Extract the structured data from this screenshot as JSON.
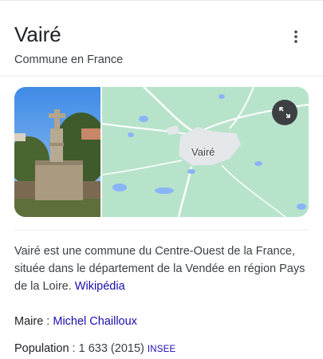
{
  "header": {
    "title": "Vairé",
    "subtitle": "Commune en France"
  },
  "map": {
    "label": "Vairé"
  },
  "description": {
    "text": "Vairé est une commune du Centre-Ouest de la France, située dans le département de la Vendée en région Pays de la Loire.",
    "source": "Wikipédia"
  },
  "facts": {
    "mayor_label": "Maire",
    "mayor_sep": " : ",
    "mayor_value": "Michel Chailloux",
    "population_label": "Population",
    "population_value": " : 1 633 (2015) ",
    "population_source": "INSEE"
  },
  "colors": {
    "link": "#1a0dab",
    "map_land": "#b7e3cb",
    "map_water": "#8ab4f8"
  }
}
